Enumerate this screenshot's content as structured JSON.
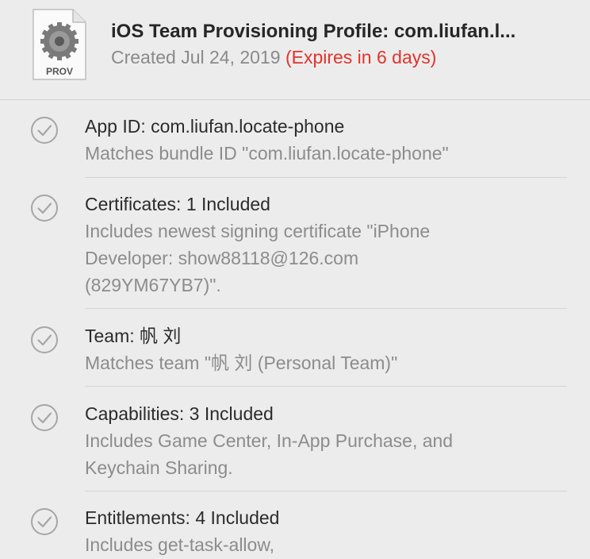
{
  "header": {
    "icon_label": "PROV",
    "title": "iOS Team Provisioning Profile: com.liufan.l...",
    "created": "Created Jul 24, 2019",
    "expires": "(Expires in 6 days)",
    "colors": {
      "expires": "#e0342c",
      "secondary": "#8a8a8a"
    }
  },
  "items": [
    {
      "heading": "App ID: com.liufan.locate-phone",
      "detail": "Matches bundle ID \"com.liufan.locate-phone\"",
      "icon": "checkmark-circle-icon"
    },
    {
      "heading": "Certificates: 1 Included",
      "detail": "Includes newest signing certificate \"iPhone\nDeveloper: show88118@126.com\n(829YM67YB7)\".",
      "icon": "checkmark-circle-icon"
    },
    {
      "heading": "Team: 帆 刘",
      "detail": "Matches team \"帆 刘 (Personal Team)\"",
      "icon": "checkmark-circle-icon"
    },
    {
      "heading": "Capabilities: 3 Included",
      "detail": "Includes Game Center, In-App Purchase, and\nKeychain Sharing.",
      "icon": "checkmark-circle-icon"
    },
    {
      "heading": "Entitlements: 4 Included",
      "detail": "Includes get-task-allow,",
      "icon": "checkmark-circle-icon"
    }
  ]
}
